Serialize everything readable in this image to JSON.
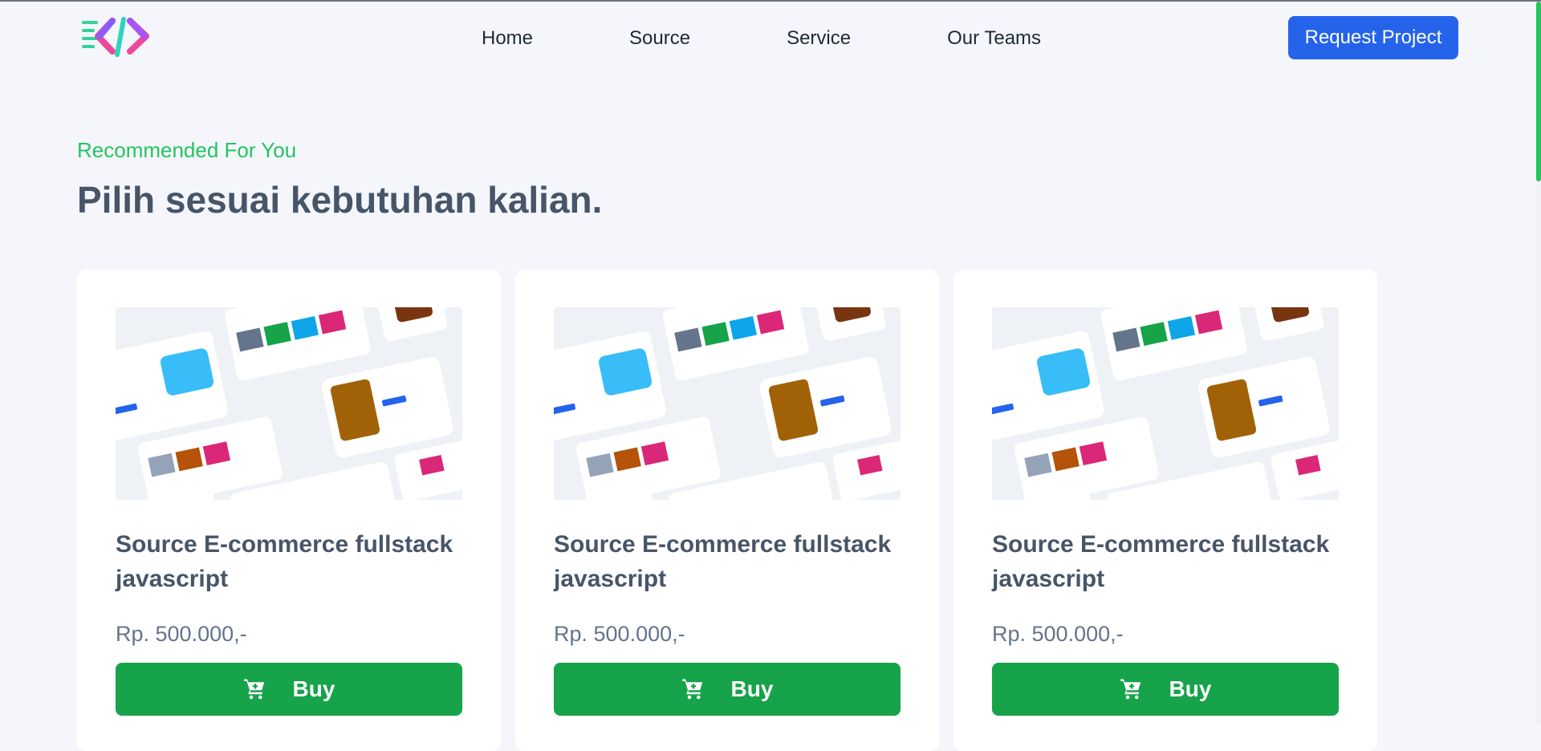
{
  "nav": {
    "links": [
      "Home",
      "Source",
      "Service",
      "Our Teams"
    ],
    "cta": "Request Project"
  },
  "section": {
    "eyebrow": "Recommended For You",
    "headline": "Pilih sesuai kebutuhan kalian."
  },
  "cards": [
    {
      "title": "Source E-commerce fullstack javascript",
      "price": "Rp. 500.000,-",
      "button": "Buy"
    },
    {
      "title": "Source E-commerce fullstack javascript",
      "price": "Rp. 500.000,-",
      "button": "Buy"
    },
    {
      "title": "Source E-commerce fullstack javascript",
      "price": "Rp. 500.000,-",
      "button": "Buy"
    }
  ],
  "colors": {
    "accent_green": "#22c55e",
    "button_green": "#16a34a",
    "primary_blue": "#2563eb",
    "background": "#f5f6fb"
  },
  "icons": {
    "logo": "code-brackets-logo",
    "cart": "cart-icon"
  }
}
